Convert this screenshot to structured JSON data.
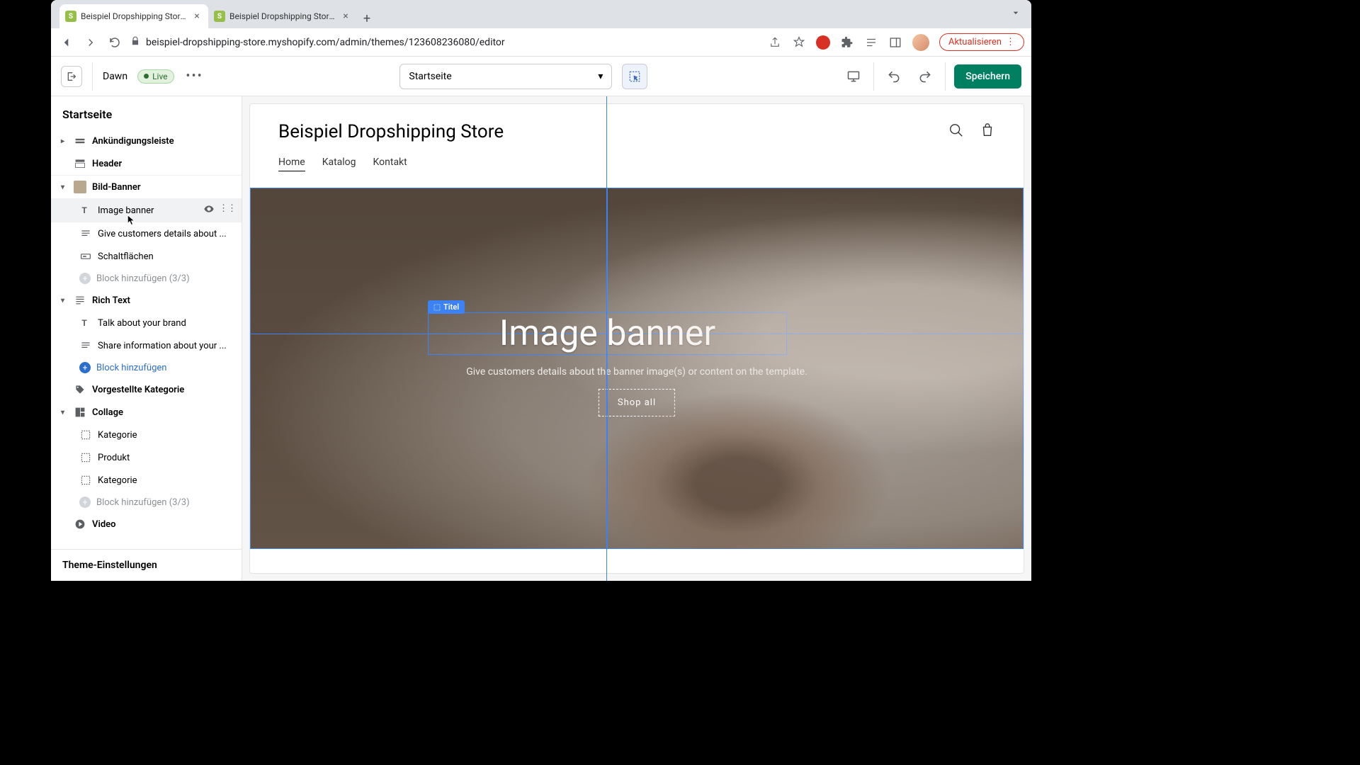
{
  "browser": {
    "tabs": [
      {
        "title": "Beispiel Dropshipping Store · D"
      },
      {
        "title": "Beispiel Dropshipping Store · E"
      }
    ],
    "url": "beispiel-dropshipping-store.myshopify.com/admin/themes/123608236080/editor",
    "update_label": "Aktualisieren"
  },
  "toolbar": {
    "theme_name": "Dawn",
    "live_label": "Live",
    "page_selector": "Startseite",
    "save_label": "Speichern"
  },
  "sidebar": {
    "title": "Startseite",
    "items": {
      "announcement": "Ankündigungsleiste",
      "header": "Header",
      "bild_banner": "Bild-Banner",
      "image_banner": "Image banner",
      "give_details": "Give customers details about ...",
      "schalt": "Schaltflächen",
      "add_block_33": "Block hinzufügen (3/3)",
      "rich_text": "Rich Text",
      "talk_brand": "Talk about your brand",
      "share_info": "Share information about your ...",
      "add_block": "Block hinzufügen",
      "featured": "Vorgestellte Kategorie",
      "collage": "Collage",
      "kategorie": "Kategorie",
      "produkt": "Produkt",
      "kategorie2": "Kategorie",
      "add_block_33b": "Block hinzufügen (3/3)",
      "video": "Video"
    },
    "footer": "Theme-Einstellungen"
  },
  "preview": {
    "store_name": "Beispiel Dropshipping Store",
    "nav": {
      "home": "Home",
      "katalog": "Katalog",
      "kontakt": "Kontakt"
    },
    "banner": {
      "titel_tag": "Titel",
      "title": "Image banner",
      "subtitle": "Give customers details about the banner image(s) or content on the template.",
      "button": "Shop all"
    }
  }
}
